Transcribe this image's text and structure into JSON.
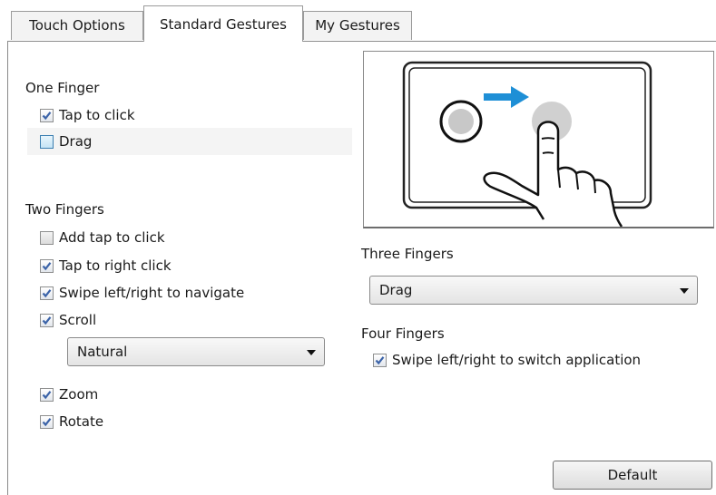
{
  "tabs": [
    {
      "label": "Touch Options"
    },
    {
      "label": "Standard Gestures"
    },
    {
      "label": "My Gestures"
    }
  ],
  "one_finger": {
    "label": "One Finger",
    "options": [
      {
        "label": "Tap to click",
        "checked": true
      },
      {
        "label": "Drag",
        "checked": false
      }
    ]
  },
  "two_fingers": {
    "label": "Two Fingers",
    "options": [
      {
        "label": "Add tap to click",
        "checked": false
      },
      {
        "label": "Tap to right click",
        "checked": true
      },
      {
        "label": "Swipe left/right to navigate",
        "checked": true
      },
      {
        "label": "Scroll",
        "checked": true
      },
      {
        "label": "Zoom",
        "checked": true
      },
      {
        "label": "Rotate",
        "checked": true
      }
    ],
    "scroll_mode": "Natural"
  },
  "three_fingers": {
    "label": "Three Fingers",
    "selected": "Drag"
  },
  "four_fingers": {
    "label": "Four Fingers",
    "options": [
      {
        "label": "Swipe left/right to switch application",
        "checked": true
      }
    ]
  },
  "default_button": "Default",
  "colors": {
    "arrow": "#1e8fd6",
    "touch_point": "#c8c8c8",
    "check": "#3b63a8"
  }
}
